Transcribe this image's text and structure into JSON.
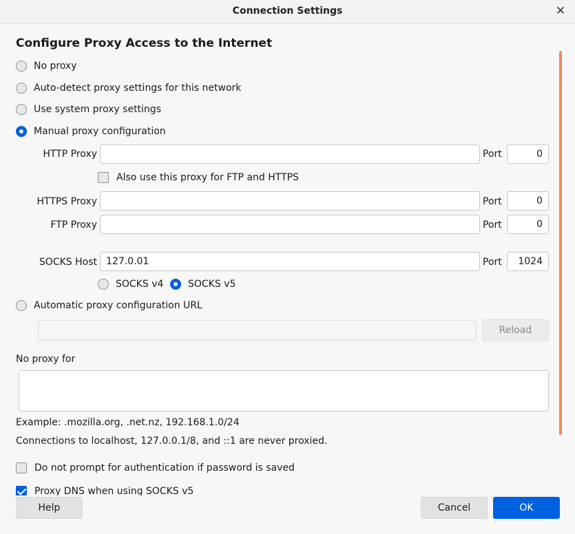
{
  "window": {
    "title": "Connection Settings",
    "close_glyph": "✕"
  },
  "heading": "Configure Proxy Access to the Internet",
  "proxy_modes": [
    {
      "label": "No proxy",
      "checked": false
    },
    {
      "label": "Auto-detect proxy settings for this network",
      "checked": false
    },
    {
      "label": "Use system proxy settings",
      "checked": false
    },
    {
      "label": "Manual proxy configuration",
      "checked": true
    },
    {
      "label": "Automatic proxy configuration URL",
      "checked": false
    }
  ],
  "manual": {
    "http_label": "HTTP Proxy",
    "http_value": "",
    "http_port": "0",
    "also_use_label": "Also use this proxy for FTP and HTTPS",
    "https_label": "HTTPS Proxy",
    "https_value": "",
    "https_port": "0",
    "ftp_label": "FTP Proxy",
    "ftp_value": "",
    "ftp_port": "0",
    "socks_label": "SOCKS Host",
    "socks_value": "127.0.01",
    "socks_port": "1024",
    "port_label": "Port",
    "socks_v4_label": "SOCKS v4",
    "socks_v5_label": "SOCKS v5"
  },
  "auto_url": {
    "value": "",
    "reload_label": "Reload"
  },
  "no_proxy": {
    "label": "No proxy for",
    "value": "",
    "example": "Example: .mozilla.org, .net.nz, 192.168.1.0/24",
    "note": "Connections to localhost, 127.0.0.1/8, and ::1 are never proxied."
  },
  "options": {
    "no_prompt_label": "Do not prompt for authentication if password is saved",
    "proxy_dns_label": "Proxy DNS when using SOCKS v5"
  },
  "buttons": {
    "help": "Help",
    "cancel": "Cancel",
    "ok": "OK"
  },
  "colors": {
    "accent": "#0060df",
    "scroll_indicator": "#f08a5d"
  }
}
